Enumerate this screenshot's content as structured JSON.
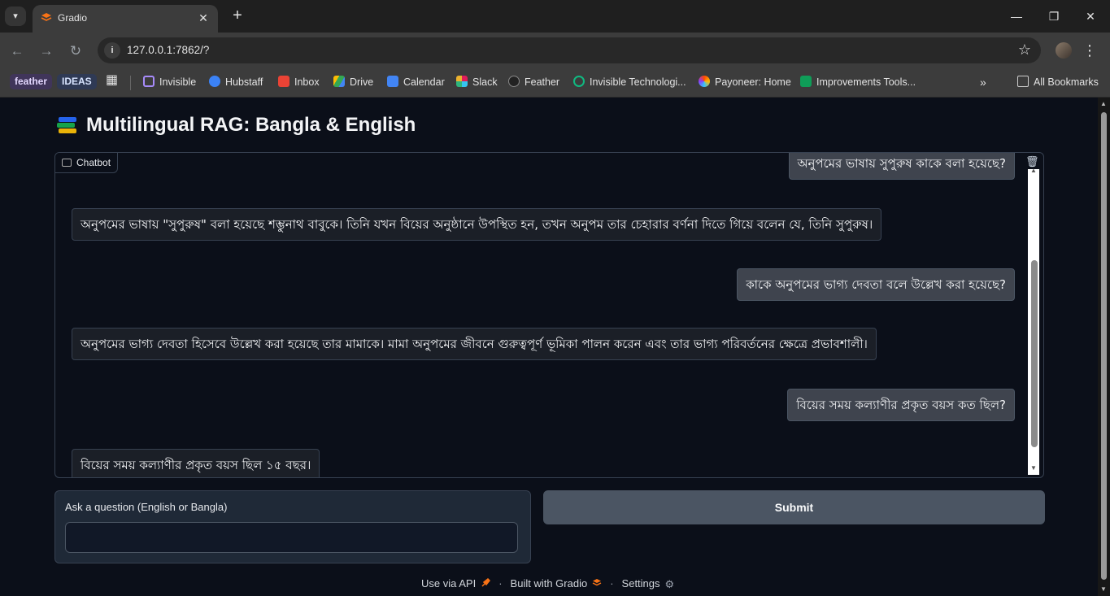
{
  "browser": {
    "tab_title": "Gradio",
    "new_tab": "+",
    "url": "127.0.0.1:7862/?",
    "window_controls": {
      "minimize": "—",
      "restore": "❐",
      "close": "✕"
    }
  },
  "bookmarks": {
    "pills": [
      "feather",
      "IDEAS"
    ],
    "items": [
      "Invisible",
      "Hubstaff",
      "Inbox",
      "Drive",
      "Calendar",
      "Slack",
      "Feather",
      "Invisible Technologi...",
      "Payoneer: Home",
      "Improvements Tools..."
    ],
    "overflow": "»",
    "all_bookmarks": "All Bookmarks"
  },
  "app": {
    "title": "Multilingual RAG: Bangla & English",
    "chatbot_label": "Chatbot",
    "messages": [
      {
        "role": "user",
        "text": "অনুপমের ভাষায় সুপুরুষ কাকে বলা হয়েছে?"
      },
      {
        "role": "bot",
        "text": "অনুপমের ভাষায় \"সুপুরুষ\" বলা হয়েছে শম্ভুনাথ বাবুকে। তিনি যখন বিয়ের অনুষ্ঠানে উপস্থিত হন, তখন অনুপম তার চেহারার বর্ণনা দিতে গিয়ে বলেন যে, তিনি সুপুরুষ।"
      },
      {
        "role": "user",
        "text": "কাকে অনুপমের ভাগ্য দেবতা বলে উল্লেখ করা হয়েছে?"
      },
      {
        "role": "bot",
        "text": "অনুপমের ভাগ্য দেবতা হিসেবে উল্লেখ করা হয়েছে তার মামাকে। মামা অনুপমের জীবনে গুরুত্বপূর্ণ ভূমিকা পালন করেন এবং তার ভাগ্য পরিবর্তনের ক্ষেত্রে প্রভাবশালী।"
      },
      {
        "role": "user",
        "text": "বিয়ের সময় কল্যাণীর প্রকৃত বয়স কত ছিল?"
      },
      {
        "role": "bot",
        "text": "বিয়ের সময় কল্যাণীর প্রকৃত বয়স ছিল ১৫ বছর।"
      }
    ],
    "input_label": "Ask a question (English or Bangla)",
    "input_value": "",
    "submit_label": "Submit",
    "footer": {
      "api": "Use via API",
      "built": "Built with Gradio",
      "settings": "Settings",
      "separator": "·"
    }
  },
  "colors": {
    "background": "#0b0f19",
    "user_bubble": "#3f444e",
    "bot_bubble": "#1b1f27",
    "submit": "#4b5563"
  }
}
